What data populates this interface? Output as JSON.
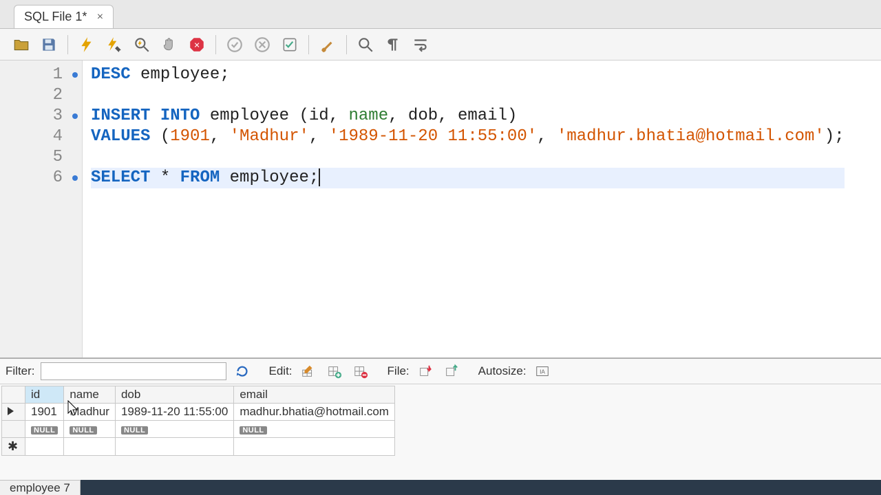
{
  "tab": {
    "title": "SQL File 1*"
  },
  "editor": {
    "lines": [
      {
        "n": 1,
        "marked": true
      },
      {
        "n": 2,
        "marked": false
      },
      {
        "n": 3,
        "marked": true
      },
      {
        "n": 4,
        "marked": false
      },
      {
        "n": 5,
        "marked": false
      },
      {
        "n": 6,
        "marked": true
      }
    ],
    "tokens": {
      "desc": "DESC",
      "employee": "employee",
      "insert": "INSERT",
      "into": "INTO",
      "lparen": "(",
      "id_col": "id",
      "name_col": "name",
      "dob_col": "dob",
      "email_col": "email",
      "rparen": ")",
      "values": "VALUES",
      "n1901": "1901",
      "s_madhur": "'Madhur'",
      "s_dob": "'1989-11-20 11:55:00'",
      "s_email": "'madhur.bhatia@hotmail.com'",
      "select": "SELECT",
      "star": "*",
      "from": "FROM",
      "semi": ";",
      "comma": ","
    }
  },
  "results_toolbar": {
    "filter_label": "Filter:",
    "filter_value": "",
    "edit_label": "Edit:",
    "file_label": "File:",
    "autosize_label": "Autosize:"
  },
  "grid": {
    "columns": [
      "id",
      "name",
      "dob",
      "email"
    ],
    "rows": [
      {
        "id": "1901",
        "name": "Madhur",
        "dob": "1989-11-20 11:55:00",
        "email": "madhur.bhatia@hotmail.com"
      }
    ],
    "null_label": "NULL"
  },
  "bottom_tab": {
    "label": "employee 7"
  }
}
